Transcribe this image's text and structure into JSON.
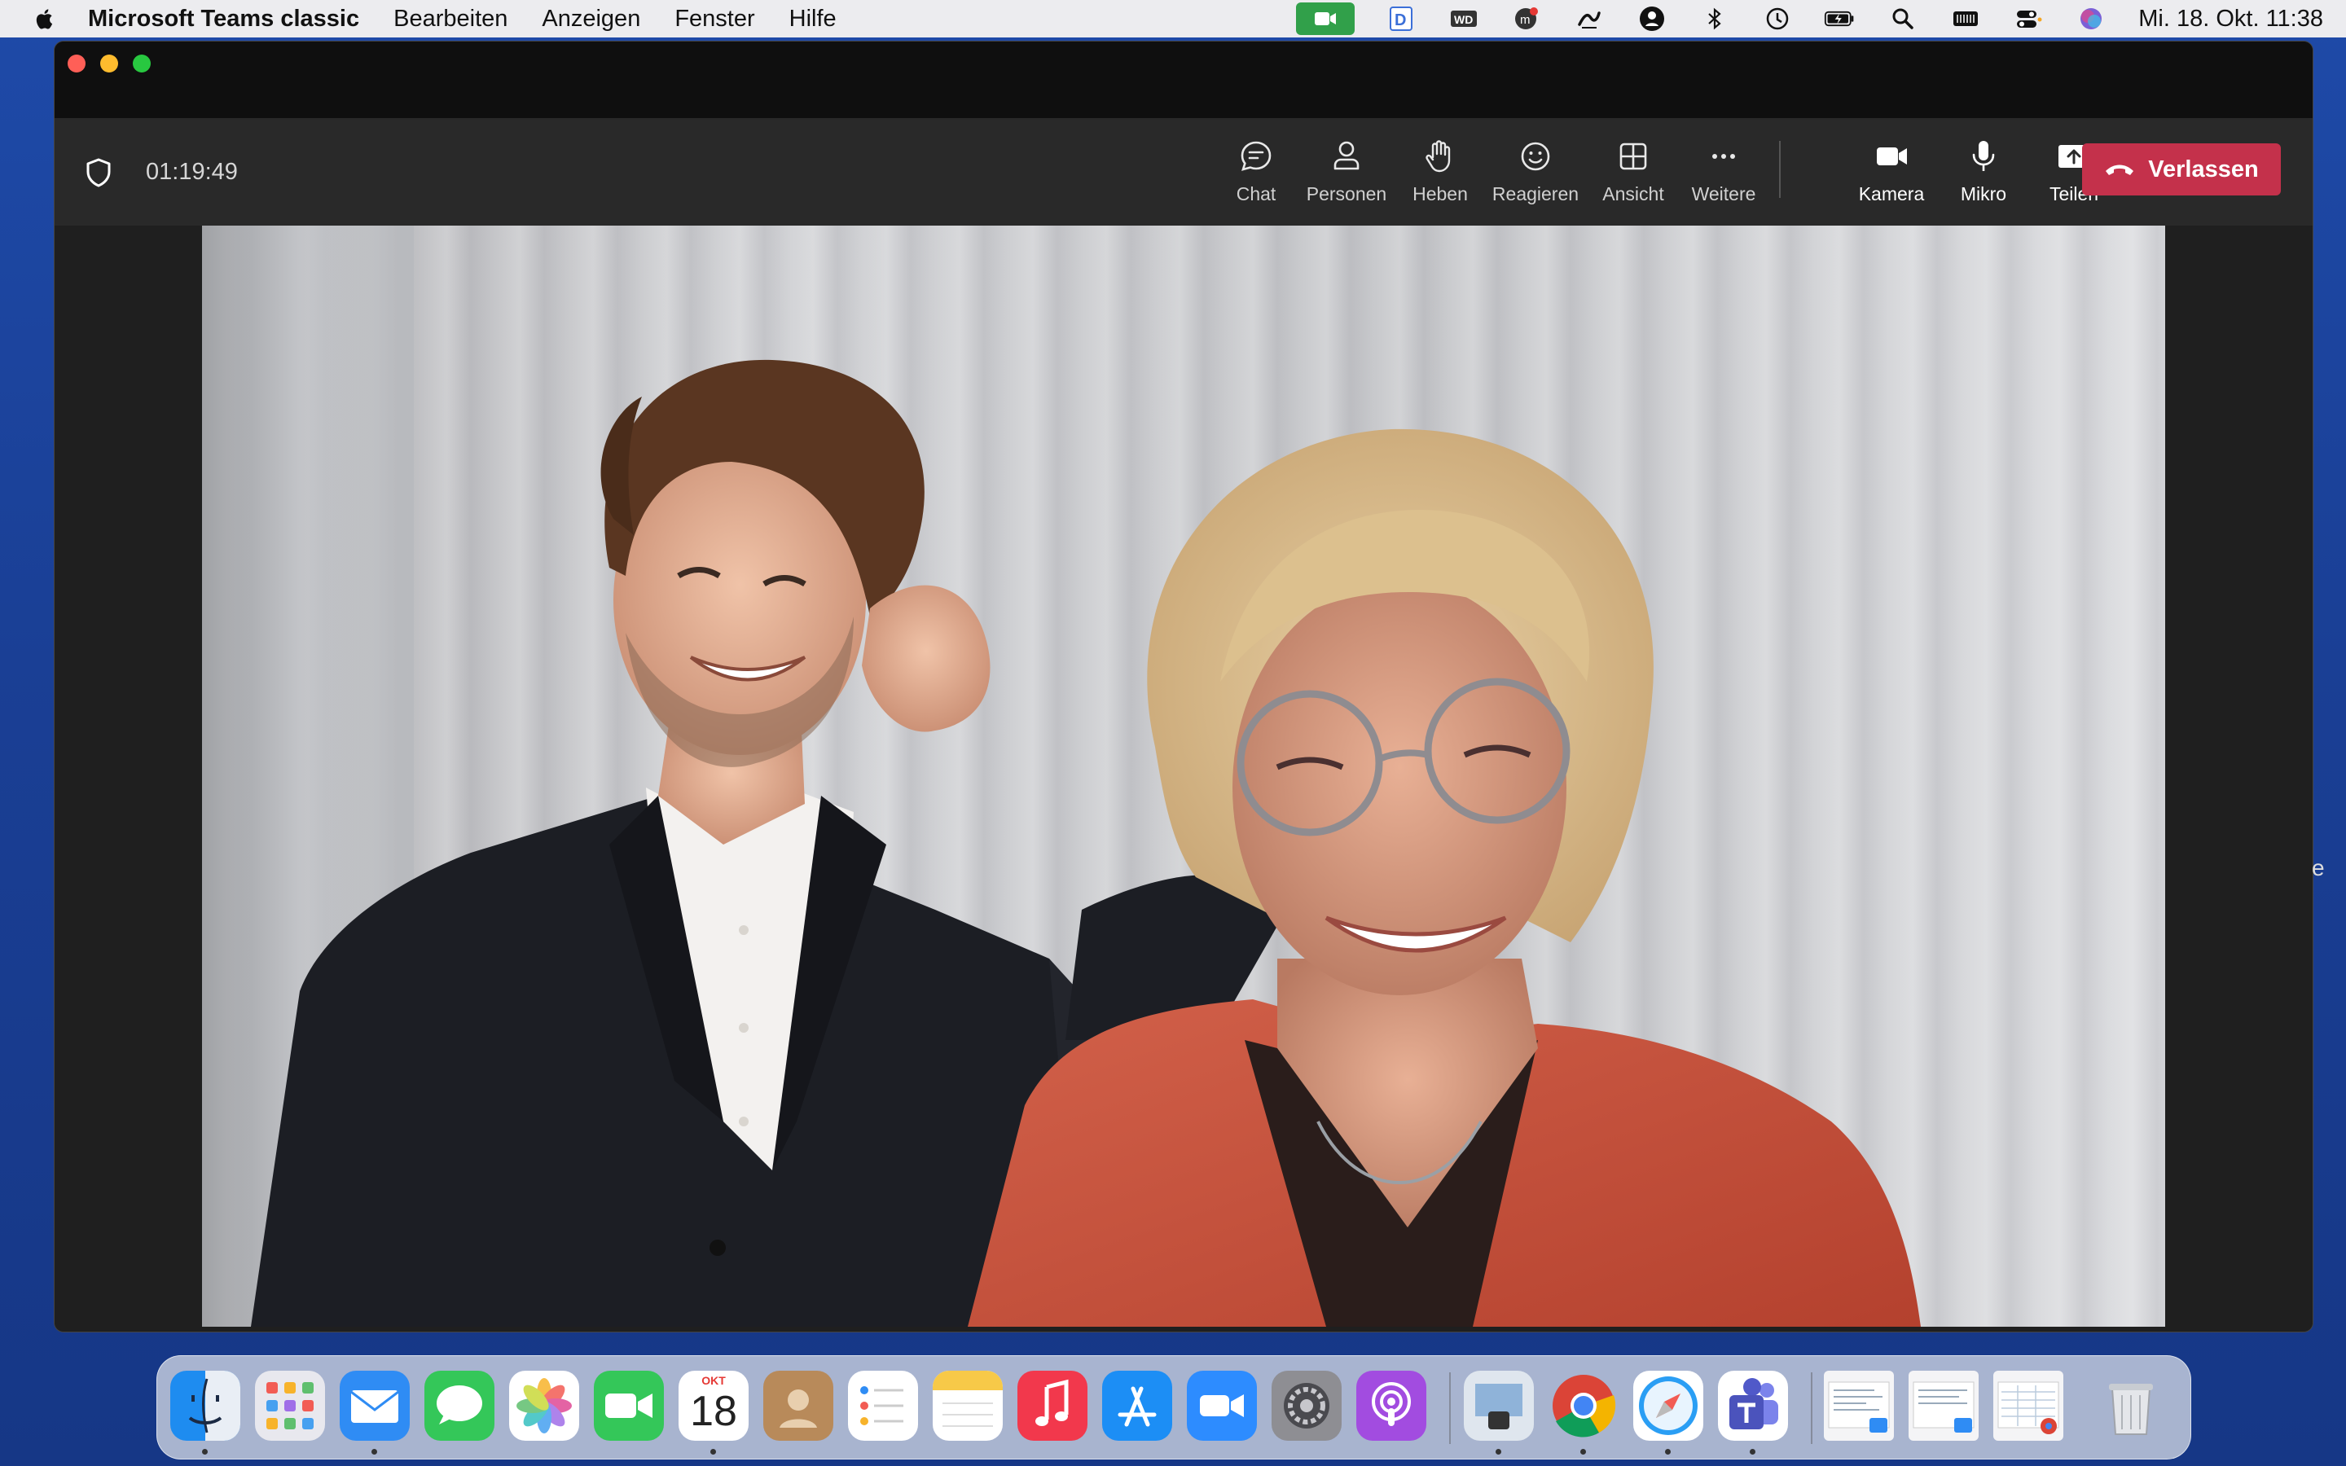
{
  "menubar": {
    "app_name": "Microsoft Teams classic",
    "menus": [
      "Bearbeiten",
      "Anzeigen",
      "Fenster",
      "Hilfe"
    ],
    "clock": "Mi. 18. Okt. 11:38",
    "status_icons": [
      "facetime-camera-icon",
      "dictation-icon",
      "wd-drive-icon",
      "messenger-icon",
      "pen-icon",
      "user-control-icon",
      "bluetooth-icon",
      "time-machine-icon",
      "battery-icon",
      "spotlight-icon",
      "keyboard-icon",
      "control-center-icon",
      "siri-icon"
    ]
  },
  "meeting": {
    "timer": "01:19:49",
    "controls": [
      {
        "id": "chat",
        "label": "Chat"
      },
      {
        "id": "people",
        "label": "Personen"
      },
      {
        "id": "raise",
        "label": "Heben"
      },
      {
        "id": "react",
        "label": "Reagieren"
      },
      {
        "id": "view",
        "label": "Ansicht"
      },
      {
        "id": "more",
        "label": "Weitere"
      },
      {
        "id": "camera",
        "label": "Kamera"
      },
      {
        "id": "mic",
        "label": "Mikro"
      },
      {
        "id": "share",
        "label": "Teilen"
      }
    ],
    "leave_label": "Verlassen",
    "leave_color": "#c4314b"
  },
  "edge_text": "e",
  "dock": {
    "apps": [
      "finder-icon",
      "launchpad-icon",
      "mail-icon",
      "messages-icon",
      "photos-icon",
      "facetime-icon",
      "calendar-icon",
      "contacts-icon",
      "reminders-icon",
      "notes-icon",
      "music-icon",
      "app-store-icon",
      "zoom-icon",
      "system-settings-icon",
      "podcasts-icon",
      "preview-icon",
      "chrome-icon",
      "safari-icon",
      "teams-icon",
      "window-thumb-1-icon",
      "window-thumb-2-icon",
      "window-thumb-3-icon",
      "trash-icon"
    ],
    "calendar": {
      "month": "OKT",
      "day": "18"
    }
  }
}
